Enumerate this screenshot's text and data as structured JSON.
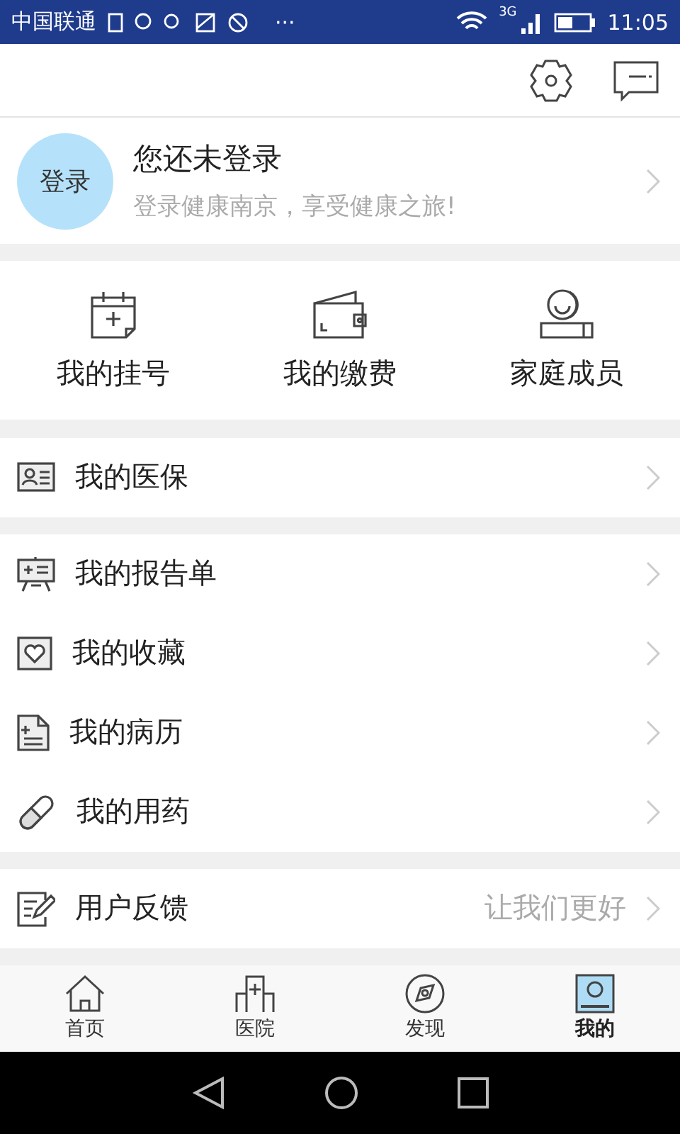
{
  "status_bar": {
    "carrier": "中国联通",
    "more": "···",
    "network": "3G",
    "time": "11:05"
  },
  "login": {
    "avatar": "登录",
    "title": "您还未登录",
    "subtitle": "登录健康南京，享受健康之旅!"
  },
  "shortcuts": [
    {
      "kind": "calendar",
      "label": "我的挂号"
    },
    {
      "kind": "wallet",
      "label": "我的缴费"
    },
    {
      "kind": "family",
      "label": "家庭成员"
    }
  ],
  "menu_groups": [
    [
      {
        "kind": "card",
        "label": "我的医保"
      }
    ],
    [
      {
        "kind": "report",
        "label": "我的报告单"
      },
      {
        "kind": "heart",
        "label": "我的收藏"
      },
      {
        "kind": "document",
        "label": "我的病历"
      },
      {
        "kind": "pill",
        "label": "我的用药"
      }
    ],
    [
      {
        "kind": "feedback",
        "label": "用户反馈",
        "hint": "让我们更好"
      }
    ]
  ],
  "tabs": [
    {
      "kind": "home",
      "label": "首页",
      "selected": false
    },
    {
      "kind": "hospital",
      "label": "医院",
      "selected": false
    },
    {
      "kind": "compass",
      "label": "发现",
      "selected": false
    },
    {
      "kind": "profile",
      "label": "我的",
      "selected": true
    }
  ]
}
